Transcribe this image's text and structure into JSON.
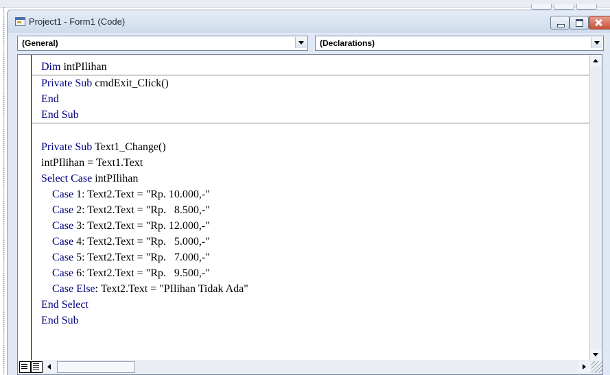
{
  "window": {
    "title": "Project1 - Form1 (Code)"
  },
  "combos": {
    "object": "(General)",
    "procedure": "(Declarations)"
  },
  "code": {
    "section1": [
      [
        {
          "t": "Dim ",
          "k": true
        },
        {
          "t": "intPIlihan",
          "k": false
        }
      ]
    ],
    "section2": [
      [
        {
          "t": "Private Sub ",
          "k": true
        },
        {
          "t": "cmdExit_Click()",
          "k": false
        }
      ],
      [
        {
          "t": "End",
          "k": true
        }
      ],
      [
        {
          "t": "End Sub",
          "k": true
        }
      ]
    ],
    "section3": [
      [
        {
          "t": "",
          "k": false
        }
      ],
      [
        {
          "t": "Private Sub ",
          "k": true
        },
        {
          "t": "Text1_Change()",
          "k": false
        }
      ],
      [
        {
          "t": "intPIlihan = Text1.Text",
          "k": false
        }
      ],
      [
        {
          "t": "Select Case ",
          "k": true
        },
        {
          "t": "intPIlihan",
          "k": false
        }
      ],
      [
        {
          "t": "    Case ",
          "k": true
        },
        {
          "t": "1: Text2.Text = \"Rp. 10.000,-\"",
          "k": false
        }
      ],
      [
        {
          "t": "    Case ",
          "k": true
        },
        {
          "t": "2: Text2.Text = \"Rp.   8.500,-\"",
          "k": false
        }
      ],
      [
        {
          "t": "    Case ",
          "k": true
        },
        {
          "t": "3: Text2.Text = \"Rp. 12.000,-\"",
          "k": false
        }
      ],
      [
        {
          "t": "    Case ",
          "k": true
        },
        {
          "t": "4: Text2.Text = \"Rp.   5.000,-\"",
          "k": false
        }
      ],
      [
        {
          "t": "    Case ",
          "k": true
        },
        {
          "t": "5: Text2.Text = \"Rp.   7.000,-\"",
          "k": false
        }
      ],
      [
        {
          "t": "    Case ",
          "k": true
        },
        {
          "t": "6: Text2.Text = \"Rp.   9.500,-\"",
          "k": false
        }
      ],
      [
        {
          "t": "    Case Else",
          "k": true
        },
        {
          "t": ": Text2.Text = \"PIlihan Tidak Ada\"",
          "k": false
        }
      ],
      [
        {
          "t": "End Select",
          "k": true
        }
      ],
      [
        {
          "t": "End Sub",
          "k": true
        }
      ]
    ]
  },
  "colors": {
    "keyword": "#000080",
    "text": "#000000",
    "window_bg": "#dfe8f4"
  },
  "icons": {
    "app": "vb-form-icon",
    "minimize": "minimize-icon",
    "maximize": "maximize-icon",
    "close": "close-icon",
    "procedure_view": "procedure-view-icon",
    "full_module_view": "full-module-view-icon"
  }
}
